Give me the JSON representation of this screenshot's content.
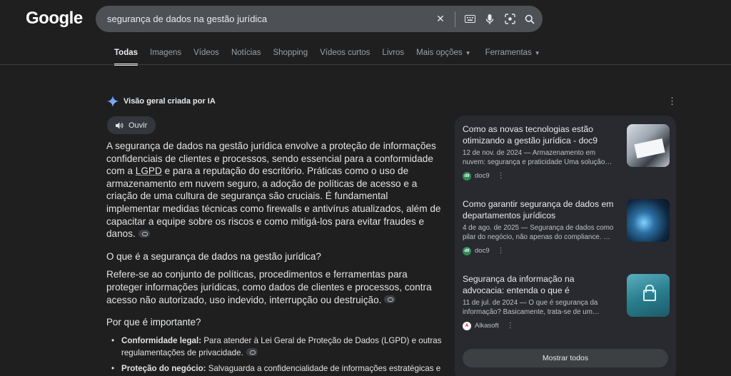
{
  "header": {
    "logo": "Google",
    "search_value": "segurança de dados na gestão jurídica"
  },
  "tabs": [
    {
      "label": "Todas",
      "active": true
    },
    {
      "label": "Imagens"
    },
    {
      "label": "Vídeos"
    },
    {
      "label": "Notícias"
    },
    {
      "label": "Shopping"
    },
    {
      "label": "Vídeos curtos"
    },
    {
      "label": "Livros"
    },
    {
      "label": "Mais opções"
    },
    {
      "label": "Ferramentas"
    }
  ],
  "ai_overview": {
    "title": "Visão geral criada por IA",
    "listen_label": "Ouvir",
    "intro_a": "A segurança de dados na gestão jurídica envolve a proteção de informações confidenciais de clientes e processos, sendo essencial para a conformidade com a ",
    "intro_link": "LGPD",
    "intro_b": " e para a reputação do escritório. Práticas como o uso de armazenamento em nuvem seguro, a adoção de políticas de acesso e a criação de uma cultura de segurança são cruciais. É fundamental implementar medidas técnicas como firewalls e antivírus atualizados, além de capacitar a equipe sobre os riscos e como mitigá-los para evitar fraudes e danos.",
    "q1": "O que é a segurança de dados na gestão jurídica?",
    "a1": "Refere-se ao conjunto de políticas, procedimentos e ferramentas para proteger informações jurídicas, como dados de clientes e processos, contra acesso não autorizado, uso indevido, interrupção ou destruição.",
    "q2": "Por que é importante?",
    "bullets": [
      {
        "bold": "Conformidade legal:",
        "text": " Para atender à Lei Geral de Proteção de Dados (LGPD) e outras regulamentações de privacidade."
      },
      {
        "bold": "Proteção do negócio:",
        "text": " Salvaguarda a confidencialidade de informações estratégicas e a reputação do escritório."
      }
    ]
  },
  "sources": [
    {
      "title": "Como as novas tecnologias estão otimizando a gestão jurídica - doc9",
      "snippet": "12 de nov. de 2024 — Armazenamento em nuvem: segurança e praticidade Uma solução…",
      "site": "doc9",
      "favicon": "d9"
    },
    {
      "title": "Como garantir segurança de dados em departamentos jurídicos",
      "snippet": "4 de ago. de 2025 — Segurança de dados como pilar do negócio, não apenas do compliance. …",
      "site": "doc9",
      "favicon": "d9"
    },
    {
      "title": "Segurança da informação na advocacia: entenda o que é",
      "snippet": "11 de jul. de 2024 — O que é segurança da informação? Basicamente, trata-se de um…",
      "site": "Alkasoft",
      "favicon": "A"
    }
  ],
  "show_all_label": "Mostrar todos",
  "colors": {
    "background": "#1f1f1f",
    "panel": "#282a2f",
    "search": "#4d5156"
  }
}
